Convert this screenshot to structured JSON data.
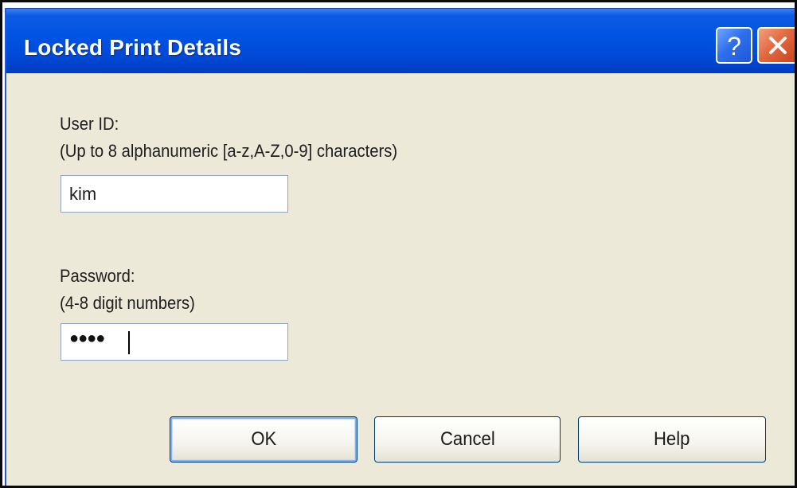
{
  "window": {
    "title": "Locked Print Details"
  },
  "titlebar_buttons": {
    "help_glyph": "?",
    "close_icon": "close-icon"
  },
  "user_id": {
    "label": "User ID:",
    "hint": "(Up to 8 alphanumeric [a-z,A-Z,0-9] characters)",
    "value": "kim"
  },
  "password": {
    "label": "Password:",
    "hint": "(4-8 digit numbers)",
    "masked_value": "●●●●"
  },
  "buttons": {
    "ok": "OK",
    "cancel": "Cancel",
    "help": "Help"
  },
  "colors": {
    "titlebar": "#0054e3",
    "dialog_bg": "#ece9d8",
    "close_button": "#e3683f",
    "help_button": "#2f6fed"
  }
}
